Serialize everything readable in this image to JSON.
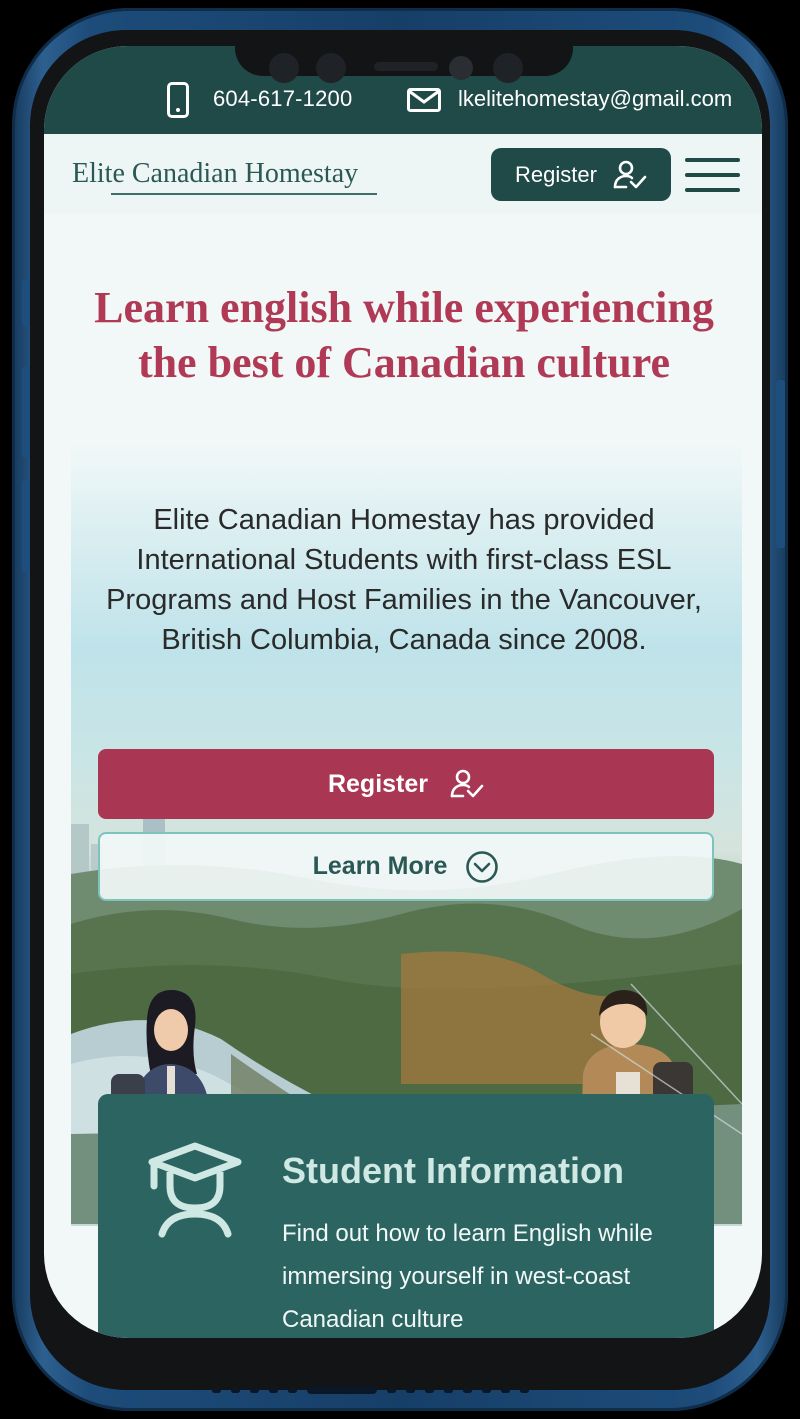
{
  "topbar": {
    "phone": "604-617-1200",
    "email": "lkelitehomestay@gmail.com",
    "phone_icon": "mobile-phone-icon",
    "mail_icon": "envelope-icon"
  },
  "nav": {
    "brand": "Elite Canadian Homestay",
    "register_label": "Register",
    "register_icon": "user-check-icon",
    "menu_icon": "hamburger-menu-icon"
  },
  "hero": {
    "title": "Learn english while experiencing the best of Canadian culture",
    "description": "Elite Canadian Homestay has provided International Students with first-class ESL Programs and Host Families in the Vancouver, British Columbia, Canada since 2008.",
    "register_label": "Register",
    "learn_more_label": "Learn More",
    "learn_more_icon": "chevron-down-circle-icon"
  },
  "student_card": {
    "title": "Student Information",
    "text": "Find out how to learn English while immersing yourself in west-coast Canadian culture",
    "icon": "graduate-student-icon"
  },
  "colors": {
    "dark_teal": "#1f4a48",
    "card_teal": "#2b6461",
    "accent_crimson": "#a93753",
    "title_crimson": "#b03a55",
    "background": "#f1f8f7"
  }
}
